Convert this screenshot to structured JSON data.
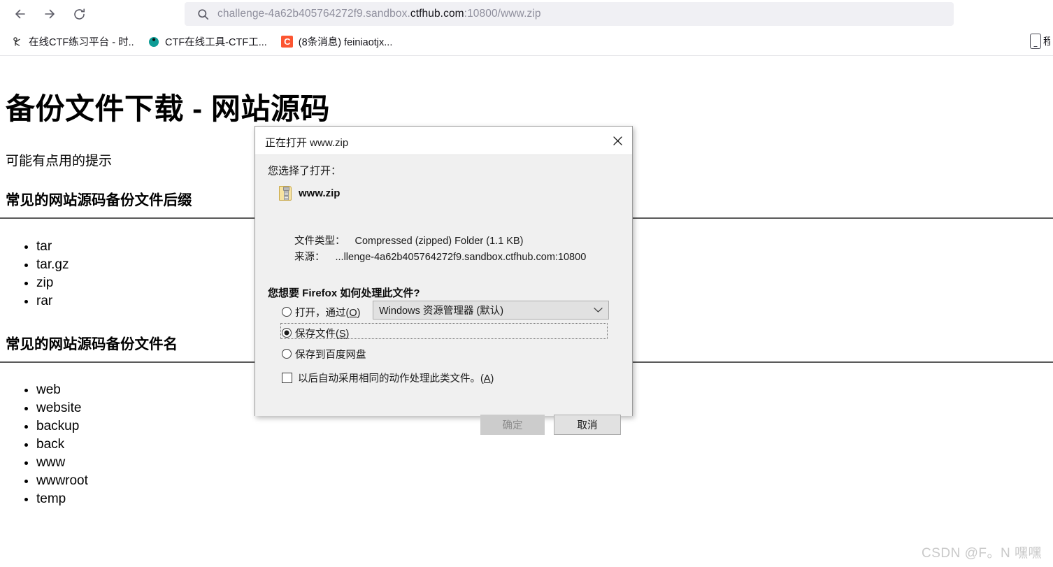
{
  "browser": {
    "nav": {
      "back_icon": "arrow-left-icon",
      "forward_icon": "arrow-right-icon",
      "reload_icon": "reload-icon"
    },
    "url_bar": {
      "search_icon": "search-icon",
      "url_prefix": "challenge-4a62b405764272f9.sandbox.",
      "url_host": "ctfhub.com",
      "url_suffix": ":10800/www.zip",
      "full_url": "challenge-4a62b405764272f9.sandbox.ctfhub.com:10800/www.zip"
    },
    "bookmarks": [
      {
        "icon": "ctf-platform-icon",
        "glyph": "⚕",
        "label": "在线CTF练习平台 - 时..."
      },
      {
        "icon": "ctf-tools-icon",
        "glyph": "◔",
        "label": "CTF在线工具-CTF工..."
      },
      {
        "icon": "csdn-icon",
        "glyph": "C",
        "label": "(8条消息) feiniaotjx..."
      }
    ],
    "bookmark_overflow": {
      "device_icon": "tablet-device-icon",
      "clipped_label": "程"
    }
  },
  "page": {
    "title": "备份文件下载 - 网站源码",
    "hint": "可能有点用的提示",
    "sections": [
      {
        "heading": "常见的网站源码备份文件后缀",
        "items": [
          "tar",
          "tar.gz",
          "zip",
          "rar"
        ]
      },
      {
        "heading": "常见的网站源码备份文件名",
        "items": [
          "web",
          "website",
          "backup",
          "back",
          "www",
          "wwwroot",
          "temp"
        ]
      }
    ],
    "watermark": "CSDN @F。N 嘿嘿"
  },
  "dialog": {
    "title": "正在打开 www.zip",
    "close_icon": "close-icon",
    "you_selected_label": "您选择了打开：",
    "file_icon": "zip-folder-icon",
    "file_name": "www.zip",
    "file_type_label": "文件类型：",
    "file_type_value": "Compressed (zipped) Folder (1.1 KB)",
    "source_label": "来源：",
    "source_value": "...llenge-4a62b405764272f9.sandbox.ctfhub.com:10800",
    "question": "您想要 Firefox 如何处理此文件?",
    "options": [
      {
        "label_pre": "打开，通过(",
        "accesskey": "O",
        "label_post": ")",
        "selected": false
      },
      {
        "label_pre": "保存文件(",
        "accesskey": "S",
        "label_post": ")",
        "selected": true
      },
      {
        "label_pre": "保存到百度网盘",
        "accesskey": "",
        "label_post": "",
        "selected": false
      }
    ],
    "app_select": {
      "value": "Windows 资源管理器 (默认)",
      "arrow_icon": "chevron-down-icon"
    },
    "remember_checkbox": {
      "checked": false,
      "label_pre": "以后自动采用相同的动作处理此类文件。(",
      "accesskey": "A",
      "label_post": ")"
    },
    "buttons": {
      "ok": "确定",
      "cancel": "取消"
    }
  },
  "colors": {
    "dialog_bg": "#f0f0f0",
    "url_bar_bg": "#f0f0f4",
    "csdn_red": "#fc5531",
    "ok_disabled": "#cccccc"
  }
}
